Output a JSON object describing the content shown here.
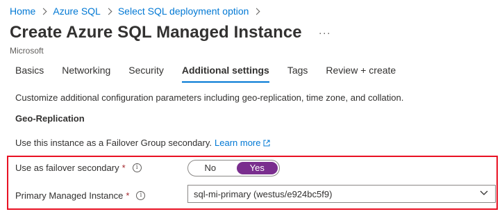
{
  "breadcrumb": {
    "items": [
      "Home",
      "Azure SQL",
      "Select SQL deployment option"
    ]
  },
  "header": {
    "title": "Create Azure SQL Managed Instance",
    "more_label": "···",
    "subtitle": "Microsoft"
  },
  "tabs": [
    {
      "label": "Basics",
      "active": false
    },
    {
      "label": "Networking",
      "active": false
    },
    {
      "label": "Security",
      "active": false
    },
    {
      "label": "Additional settings",
      "active": true
    },
    {
      "label": "Tags",
      "active": false
    },
    {
      "label": "Review + create",
      "active": false
    }
  ],
  "main": {
    "description": "Customize additional configuration parameters including geo-replication, time zone, and collation.",
    "section_heading": "Geo-Replication",
    "info_text": "Use this instance as a Failover Group secondary.",
    "learn_more": "Learn more",
    "failover": {
      "label": "Use as failover secondary",
      "required_mark": "*",
      "options": [
        "No",
        "Yes"
      ],
      "selected": "Yes"
    },
    "primary_instance": {
      "label": "Primary Managed Instance",
      "required_mark": "*",
      "value": "sql-mi-primary (westus/e924bc5f9)"
    }
  },
  "colors": {
    "link": "#0078d4",
    "accent_toggle": "#7a2e8e",
    "highlight_border": "#e81123",
    "required": "#a4262c"
  }
}
